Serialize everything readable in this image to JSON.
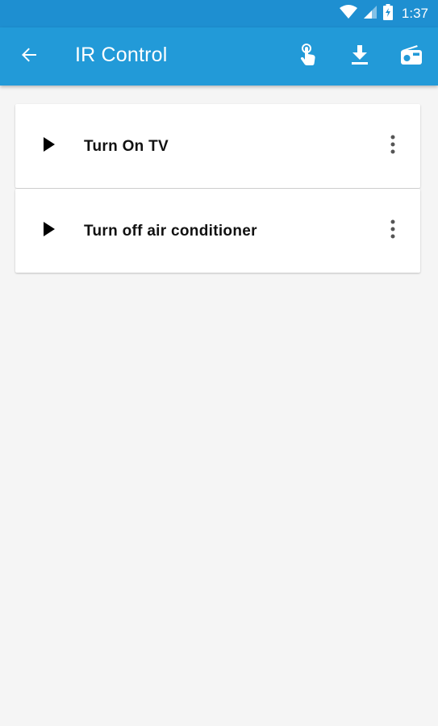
{
  "status_bar": {
    "time": "1:37",
    "icons": [
      "wifi-icon",
      "cellular-signal-icon",
      "battery-charging-icon"
    ]
  },
  "app_bar": {
    "title": "IR Control",
    "back_icon": "arrow-back-icon",
    "actions": [
      "touch-gesture-icon",
      "download-icon",
      "radio-icon"
    ]
  },
  "commands": [
    {
      "label": "Turn On TV",
      "play_icon": "play-icon",
      "menu_icon": "more-vert-icon"
    },
    {
      "label": "Turn off air conditioner",
      "play_icon": "play-icon",
      "menu_icon": "more-vert-icon"
    }
  ],
  "colors": {
    "status_bar": "#1e8fd1",
    "app_bar": "#229ad8",
    "background": "#f5f5f5",
    "card": "#ffffff"
  }
}
